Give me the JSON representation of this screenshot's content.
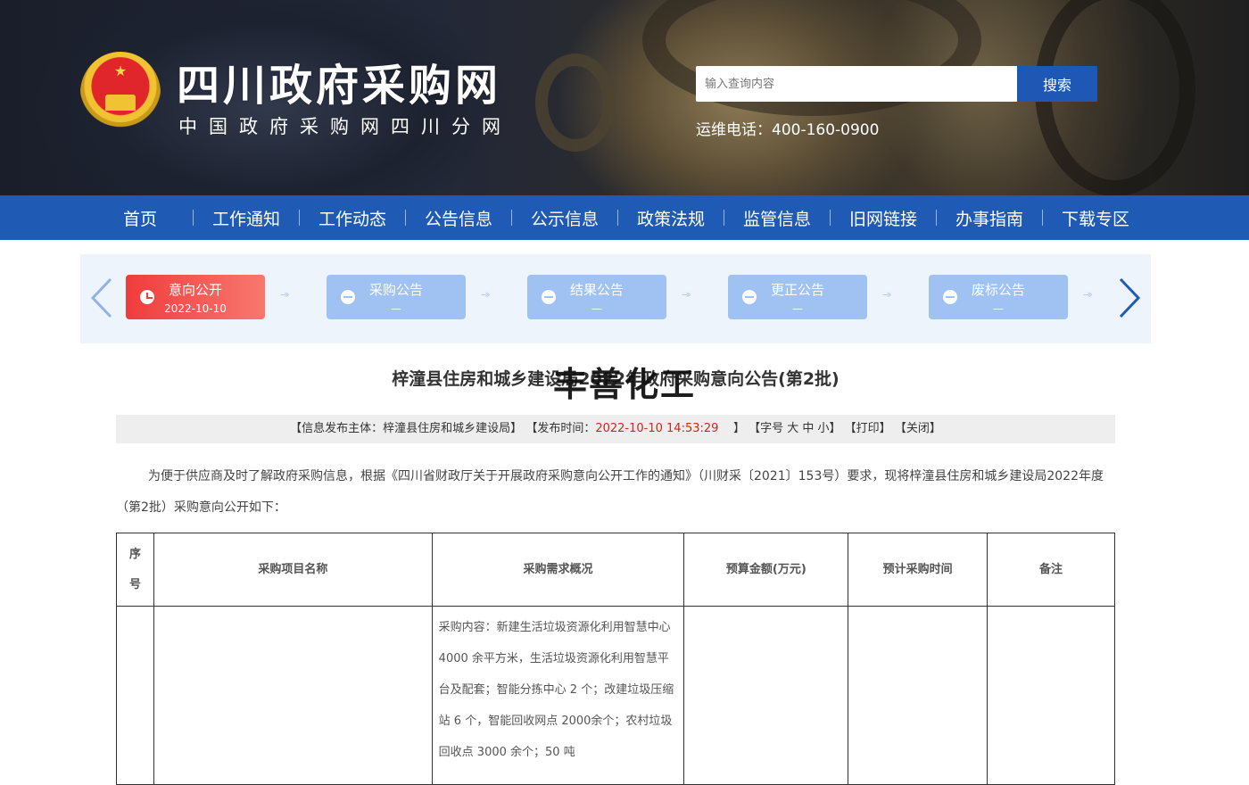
{
  "header": {
    "title": "四川政府采购网",
    "subtitle": "中国政府采购网四川分网",
    "search_placeholder": "输入查询内容",
    "search_button": "搜索",
    "hotline": "运维电话：400-160-0900"
  },
  "nav": {
    "items": [
      "首页",
      "工作通知",
      "工作动态",
      "公告信息",
      "公示信息",
      "政策法规",
      "监管信息",
      "旧网链接",
      "办事指南",
      "下载专区"
    ]
  },
  "steps": [
    {
      "name": "意向公开",
      "date": "2022-10-10",
      "state": "active"
    },
    {
      "name": "采购公告",
      "date": "—",
      "state": "inactive"
    },
    {
      "name": "结果公告",
      "date": "—",
      "state": "inactive"
    },
    {
      "name": "更正公告",
      "date": "—",
      "state": "inactive"
    },
    {
      "name": "废标公告",
      "date": "—",
      "state": "inactive"
    }
  ],
  "article": {
    "title": "梓潼县住房和城乡建设局2022年政府采购意向公告(第2批)",
    "overlay_text": "丰善化工",
    "meta": {
      "publisher_label": "【信息发布主体：梓潼县住房和城乡建设局】",
      "time_label": "【发布时间：",
      "time_value": "2022-10-10 14:53:29",
      "time_close": "】",
      "font_size_label": "【字号 大 中 小】",
      "print_label": "【打印】",
      "close_label": "【关闭】"
    },
    "intro": "为便于供应商及时了解政府采购信息，根据《四川省财政厅关于开展政府采购意向公开工作的通知》（川财采〔2021〕153号）要求，现将梓潼县住房和城乡建设局2022年度（第2批）采购意向公开如下："
  },
  "table": {
    "headers": [
      "序号",
      "采购项目名称",
      "采购需求概况",
      "预算金额(万元)",
      "预计采购时间",
      "备注"
    ],
    "rows": [
      {
        "no": "",
        "name": "",
        "requirement": "采购内容：新建生活垃圾资源化利用智慧中心 4000 余平方米，生活垃圾资源化利用智慧平台及配套；智能分拣中心 2 个；改建垃圾压缩站 6 个，智能回收网点 2000余个；农村垃圾回收点 3000 余个；50 吨",
        "budget": "",
        "time": "",
        "note": ""
      }
    ]
  },
  "colors": {
    "nav_bg": "#1f5bb5",
    "search_btn": "#1f58b4",
    "step_active": "#ef3c3c",
    "step_inactive": "#9fc2f3",
    "meta_time": "#d8221b"
  },
  "icons": [
    "national-emblem-icon",
    "clock-icon",
    "minus-circle-icon",
    "chevron-left-icon",
    "chevron-right-icon",
    "double-chevron-icon"
  ]
}
